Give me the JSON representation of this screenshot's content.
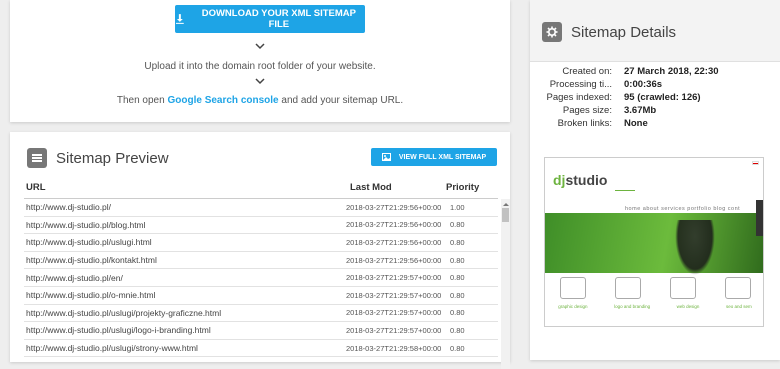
{
  "download": {
    "button_label": "DOWNLOAD YOUR XML SITEMAP FILE",
    "step1": "Upload it into the domain root folder of your website.",
    "step2_prefix": "Then open ",
    "step2_link": "Google Search console",
    "step2_suffix": " and add your sitemap URL."
  },
  "preview": {
    "title": "Sitemap Preview",
    "view_full_label": "VIEW FULL XML SITEMAP",
    "columns": {
      "url": "URL",
      "lastmod": "Last Mod",
      "priority": "Priority"
    },
    "rows": [
      {
        "url": "http://www.dj-studio.pl/",
        "lastmod": "2018-03-27T21:29:56+00:00",
        "priority": "1.00"
      },
      {
        "url": "http://www.dj-studio.pl/blog.html",
        "lastmod": "2018-03-27T21:29:56+00:00",
        "priority": "0.80"
      },
      {
        "url": "http://www.dj-studio.pl/uslugi.html",
        "lastmod": "2018-03-27T21:29:56+00:00",
        "priority": "0.80"
      },
      {
        "url": "http://www.dj-studio.pl/kontakt.html",
        "lastmod": "2018-03-27T21:29:56+00:00",
        "priority": "0.80"
      },
      {
        "url": "http://www.dj-studio.pl/en/",
        "lastmod": "2018-03-27T21:29:57+00:00",
        "priority": "0.80"
      },
      {
        "url": "http://www.dj-studio.pl/o-mnie.html",
        "lastmod": "2018-03-27T21:29:57+00:00",
        "priority": "0.80"
      },
      {
        "url": "http://www.dj-studio.pl/uslugi/projekty-graficzne.html",
        "lastmod": "2018-03-27T21:29:57+00:00",
        "priority": "0.80"
      },
      {
        "url": "http://www.dj-studio.pl/uslugi/logo-i-branding.html",
        "lastmod": "2018-03-27T21:29:57+00:00",
        "priority": "0.80"
      },
      {
        "url": "http://www.dj-studio.pl/uslugi/strony-www.html",
        "lastmod": "2018-03-27T21:29:58+00:00",
        "priority": "0.80"
      }
    ]
  },
  "details": {
    "title": "Sitemap Details",
    "rows": [
      {
        "label": "Created on:",
        "value": "27 March 2018, 22:30"
      },
      {
        "label": "Processing ti...",
        "value": "0:00:36s"
      },
      {
        "label": "Pages indexed:",
        "value": "95 (crawled: 126)"
      },
      {
        "label": "Pages size:",
        "value": "3.67Mb"
      },
      {
        "label": "Broken links:",
        "value": "None"
      }
    ]
  },
  "thumbnail": {
    "logo_dj": "dj",
    "logo_studio": "studio",
    "nav": "home   about   services   portfolio   blog   cont",
    "labels": [
      "graphic design",
      "logo and branding",
      "web design",
      "seo and sem"
    ]
  },
  "colors": {
    "accent": "#1ea4e6",
    "brand_green": "#6db33f"
  },
  "icons": [
    "download-icon",
    "chevron-down-icon",
    "list-icon",
    "image-icon",
    "gear-icon"
  ]
}
